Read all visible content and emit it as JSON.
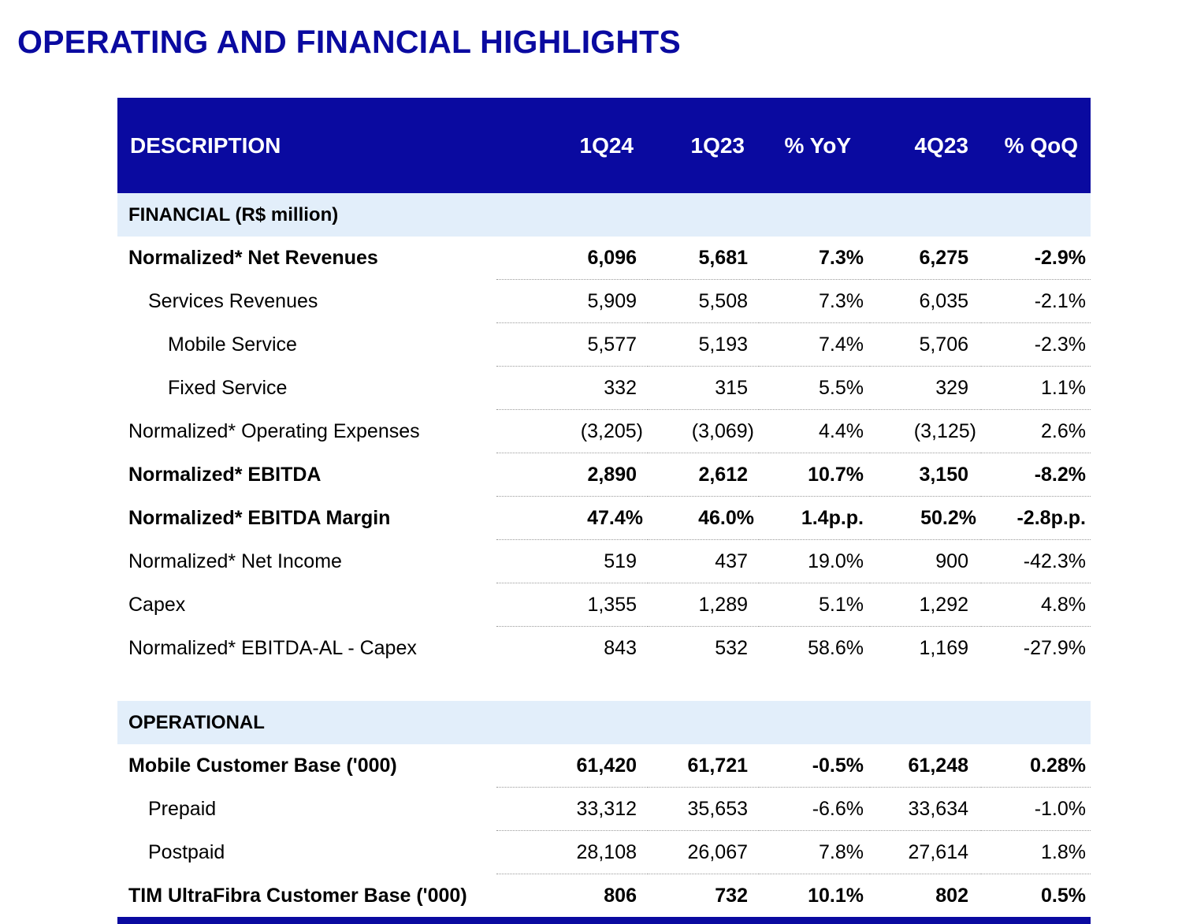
{
  "page": {
    "title": "OPERATING AND FINANCIAL HIGHLIGHTS"
  },
  "table": {
    "headers": {
      "description": "DESCRIPTION",
      "col1": "1Q24",
      "col2": "1Q23",
      "col3": "% YoY",
      "col4": "4Q23",
      "col5": "% QoQ"
    },
    "financial": {
      "section_label": "FINANCIAL (R$ million)",
      "rows": [
        {
          "label": "Normalized* Net Revenues",
          "v1": "6,096",
          "v2": "5,681",
          "v3": "7.3%",
          "v4": "6,275",
          "v5": "-2.9%"
        },
        {
          "label": "Services Revenues",
          "v1": "5,909",
          "v2": "5,508",
          "v3": "7.3%",
          "v4": "6,035",
          "v5": "-2.1%"
        },
        {
          "label": "Mobile Service",
          "v1": "5,577",
          "v2": "5,193",
          "v3": "7.4%",
          "v4": "5,706",
          "v5": "-2.3%"
        },
        {
          "label": "Fixed Service",
          "v1": "332",
          "v2": "315",
          "v3": "5.5%",
          "v4": "329",
          "v5": "1.1%"
        },
        {
          "label": "Normalized* Operating Expenses",
          "v1": "(3,205)",
          "v2": "(3,069)",
          "v3": "4.4%",
          "v4": "(3,125)",
          "v5": "2.6%"
        },
        {
          "label": "Normalized* EBITDA",
          "v1": "2,890",
          "v2": "2,612",
          "v3": "10.7%",
          "v4": "3,150",
          "v5": "-8.2%"
        },
        {
          "label": "Normalized* EBITDA Margin",
          "v1": "47.4%",
          "v2": "46.0%",
          "v3": "1.4p.p.",
          "v4": "50.2%",
          "v5": "-2.8p.p."
        },
        {
          "label": "Normalized* Net Income",
          "v1": "519",
          "v2": "437",
          "v3": "19.0%",
          "v4": "900",
          "v5": "-42.3%"
        },
        {
          "label": "Capex",
          "v1": "1,355",
          "v2": "1,289",
          "v3": "5.1%",
          "v4": "1,292",
          "v5": "4.8%"
        },
        {
          "label": "Normalized* EBITDA-AL - Capex",
          "v1": "843",
          "v2": "532",
          "v3": "58.6%",
          "v4": "1,169",
          "v5": "-27.9%"
        }
      ]
    },
    "operational": {
      "section_label": "OPERATIONAL",
      "rows": [
        {
          "label": "Mobile Customer Base ('000)",
          "v1": "61,420",
          "v2": "61,721",
          "v3": "-0.5%",
          "v4": "61,248",
          "v5": "0.28%"
        },
        {
          "label": "Prepaid",
          "v1": "33,312",
          "v2": "35,653",
          "v3": "-6.6%",
          "v4": "33,634",
          "v5": "-1.0%"
        },
        {
          "label": "Postpaid",
          "v1": "28,108",
          "v2": "26,067",
          "v3": "7.8%",
          "v4": "27,614",
          "v5": "1.8%"
        },
        {
          "label": "TIM UltraFibra Customer Base ('000)",
          "v1": "806",
          "v2": "732",
          "v3": "10.1%",
          "v4": "802",
          "v5": "0.5%"
        }
      ]
    }
  }
}
